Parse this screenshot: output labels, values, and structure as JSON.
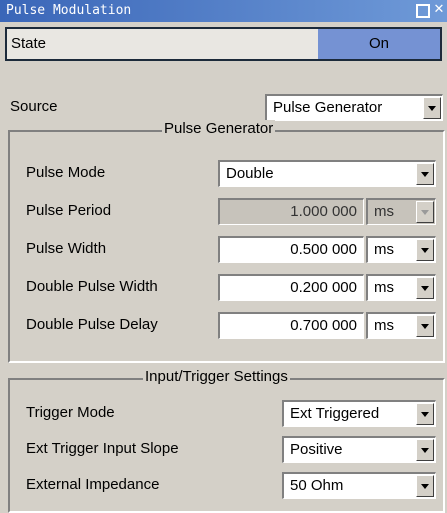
{
  "window": {
    "title": "Pulse Modulation"
  },
  "state": {
    "label": "State",
    "value": "On"
  },
  "source": {
    "label": "Source",
    "value": "Pulse Generator"
  },
  "pulse_generator": {
    "title": "Pulse Generator",
    "pulse_mode": {
      "label": "Pulse Mode",
      "value": "Double"
    },
    "pulse_period": {
      "label": "Pulse Period",
      "value": "1.000 000",
      "unit": "ms"
    },
    "pulse_width": {
      "label": "Pulse Width",
      "value": "0.500 000",
      "unit": "ms"
    },
    "double_pulse_width": {
      "label": "Double Pulse Width",
      "value": "0.200 000",
      "unit": "ms"
    },
    "double_pulse_delay": {
      "label": "Double Pulse Delay",
      "value": "0.700 000",
      "unit": "ms"
    }
  },
  "input_trigger": {
    "title": "Input/Trigger Settings",
    "trigger_mode": {
      "label": "Trigger Mode",
      "value": "Ext Triggered"
    },
    "ext_trigger_slope": {
      "label": "Ext Trigger Input Slope",
      "value": "Positive"
    },
    "external_impedance": {
      "label": "External Impedance",
      "value": "50 Ohm"
    }
  },
  "colors": {
    "title_bar": "#3a66b8",
    "state_on": "#7592d3",
    "panel": "#d4d0c8"
  }
}
